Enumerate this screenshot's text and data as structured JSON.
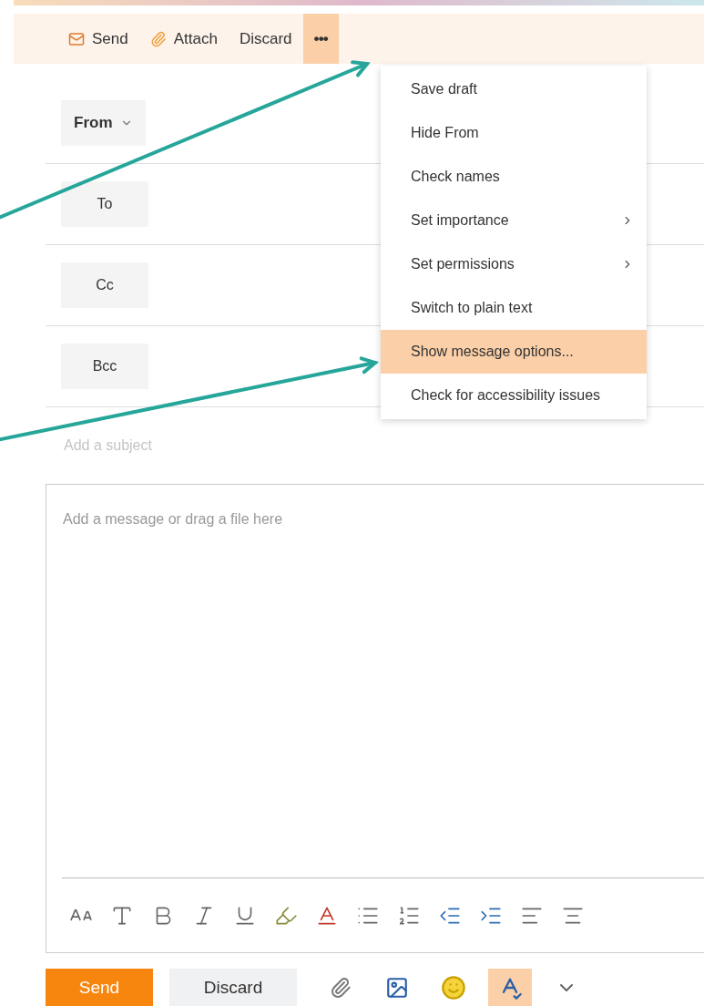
{
  "toolbar": [
    {
      "kind": "send",
      "label": "Send",
      "selected": false
    },
    {
      "kind": "attach",
      "label": "Attach",
      "selected": false
    },
    {
      "kind": "discard",
      "label": "Discard",
      "selected": false
    },
    {
      "kind": "more",
      "label": "•••",
      "selected": true
    }
  ],
  "menu": [
    {
      "label": "Save draft",
      "submenu": false,
      "selected": false
    },
    {
      "label": "Hide From",
      "submenu": false,
      "selected": false
    },
    {
      "label": "Check names",
      "submenu": false,
      "selected": false
    },
    {
      "label": "Set importance",
      "submenu": true,
      "selected": false
    },
    {
      "label": "Set permissions",
      "submenu": true,
      "selected": false
    },
    {
      "label": "Switch to plain text",
      "submenu": false,
      "selected": false
    },
    {
      "label": "Show message options...",
      "submenu": false,
      "selected": true
    },
    {
      "label": "Check for accessibility issues",
      "submenu": false,
      "selected": false
    }
  ],
  "from": {
    "label": "From"
  },
  "recipients": [
    {
      "label": "To"
    },
    {
      "label": "Cc"
    },
    {
      "label": "Bcc"
    }
  ],
  "subject": {
    "placeholder": "Add a subject"
  },
  "body": {
    "placeholder": "Add a message or drag a file here"
  },
  "actions": [
    {
      "kind": "primary",
      "label": "Send"
    },
    {
      "kind": "secondary",
      "label": "Discard"
    }
  ],
  "bottom_tools": [
    {
      "kind": "attach",
      "selected": false
    },
    {
      "kind": "image",
      "selected": false
    },
    {
      "kind": "emoji",
      "selected": false
    },
    {
      "kind": "spelling",
      "selected": true
    },
    {
      "kind": "more",
      "selected": false
    }
  ]
}
